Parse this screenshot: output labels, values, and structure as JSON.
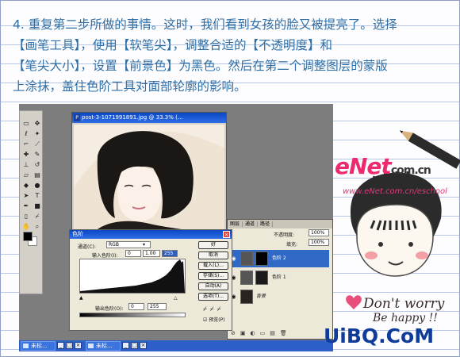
{
  "instructions": {
    "lines": [
      "4. 重复第二步所做的事情。这时，我们看到女孩的脸又被提亮了。选择",
      "【画笔工具】，使用【软笔尖】，调整合适的【不透明度】和",
      "【笔尖大小】，设置【前景色】为黑色。然后在第二个调整图层的蒙版",
      "上涂抹，盖住色阶工具对面部轮廓的影响。"
    ]
  },
  "doc_window": {
    "title": "post-3-1071991891.jpg @ 33.3% (..."
  },
  "levels_dialog": {
    "title": "色阶",
    "channel_label": "通道(C):",
    "channel_value": "RGB",
    "input_label": "输入色阶(I):",
    "input_values": [
      "0",
      "1.00",
      "255"
    ],
    "output_label": "输出色阶(O):",
    "output_values": [
      "0",
      "255"
    ],
    "buttons": [
      "好",
      "取消",
      "载入(L)...",
      "存储(S)...",
      "自动(A)",
      "选项(T)..."
    ],
    "preview_label": "预览(P)"
  },
  "layers_panel": {
    "tabs": [
      "图层",
      "通道",
      "路径"
    ],
    "opacity_label": "不透明度:",
    "opacity_value": "100%",
    "fill_label": "填充:",
    "fill_value": "100%",
    "layers": [
      {
        "name": "色阶 2",
        "selected": true
      },
      {
        "name": "色阶 1",
        "selected": false
      },
      {
        "name": "背景",
        "selected": false
      }
    ]
  },
  "taskbar": {
    "items": [
      "未标...",
      "未标..."
    ]
  },
  "watermark": {
    "brand": "eNet",
    "brand_suffix": "com.cn",
    "url": "www.eNet.com.cn/eschool",
    "dont_worry": "Don't worry",
    "be_happy": "Be happy !!",
    "site": "UiBQ.CoM"
  },
  "colors": {
    "instruction_text": "#2f6fa6",
    "brand_pink": "#ed2a6e",
    "site_blue": "#0f3b9b"
  }
}
